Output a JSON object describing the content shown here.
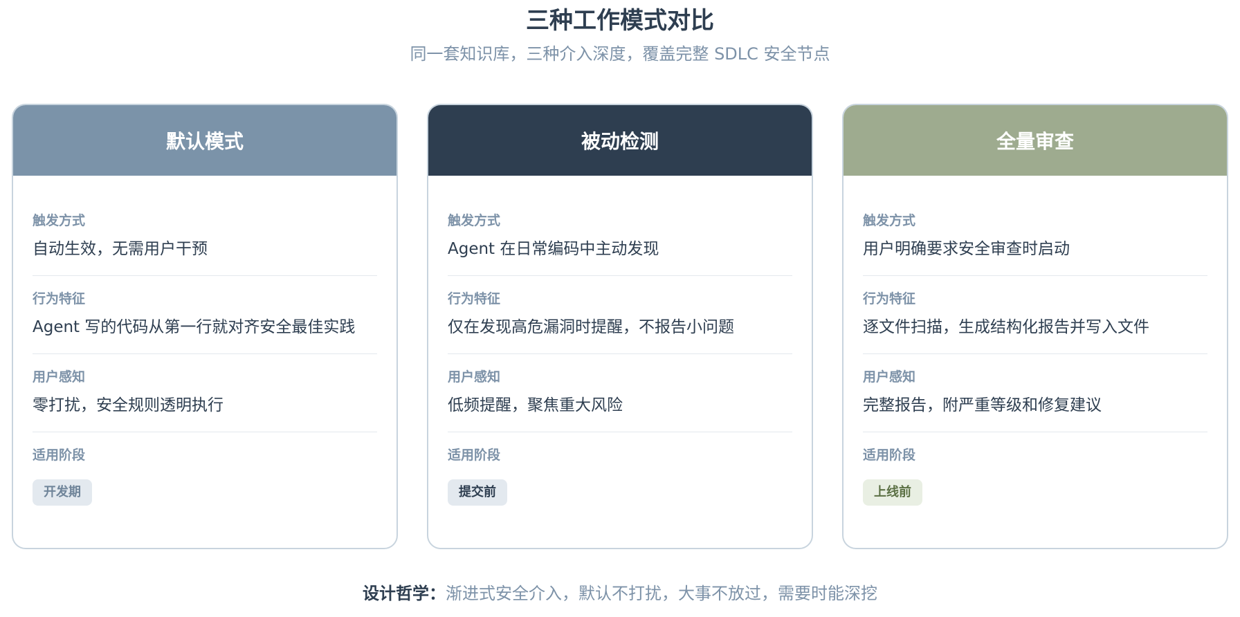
{
  "title": "三种工作模式对比",
  "subtitle": "同一套知识库，三种介入深度，覆盖完整 SDLC 安全节点",
  "colors": {
    "default_header": "#7b93a9",
    "passive_header": "#2e3e50",
    "full_header": "#9eab8f",
    "badge_default_bg": "#e3e9ef",
    "badge_default_text": "#6f8499",
    "badge_passive_bg": "#e3e9ef",
    "badge_passive_text": "#2e3e50",
    "badge_full_bg": "#e9efe3",
    "badge_full_text": "#5b7044"
  },
  "cards": [
    {
      "header": "默认模式",
      "trigger_label": "触发方式",
      "trigger_value": "自动生效，无需用户干预",
      "behavior_label": "行为特征",
      "behavior_value": "Agent 写的代码从第一行就对齐安全最佳实践",
      "perception_label": "用户感知",
      "perception_value": "零打扰，安全规则透明执行",
      "stage_label": "适用阶段",
      "stage_badge": "开发期"
    },
    {
      "header": "被动检测",
      "trigger_label": "触发方式",
      "trigger_value": "Agent 在日常编码中主动发现",
      "behavior_label": "行为特征",
      "behavior_value": "仅在发现高危漏洞时提醒，不报告小问题",
      "perception_label": "用户感知",
      "perception_value": "低频提醒，聚焦重大风险",
      "stage_label": "适用阶段",
      "stage_badge": "提交前"
    },
    {
      "header": "全量审查",
      "trigger_label": "触发方式",
      "trigger_value": "用户明确要求安全审查时启动",
      "behavior_label": "行为特征",
      "behavior_value": "逐文件扫描，生成结构化报告并写入文件",
      "perception_label": "用户感知",
      "perception_value": "完整报告，附严重等级和修复建议",
      "stage_label": "适用阶段",
      "stage_badge": "上线前"
    }
  ],
  "footer": {
    "label": "设计哲学：",
    "text": "渐进式安全介入，默认不打扰，大事不放过，需要时能深挖"
  }
}
